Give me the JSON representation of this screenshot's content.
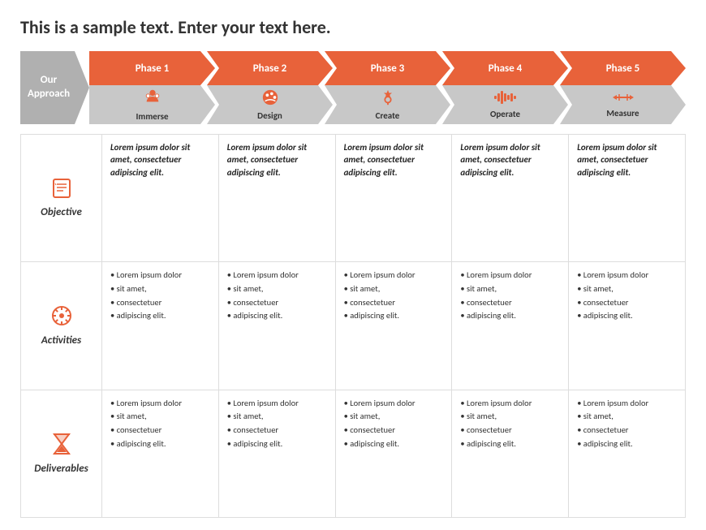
{
  "title": "This is a sample text. Enter your text here.",
  "banner": {
    "approach_label": "Our\nApproach",
    "phases": [
      {
        "phase_label": "Phase 1",
        "icon": "👤",
        "icon_unicode": "🫧",
        "sub_label": "Immerse"
      },
      {
        "phase_label": "Phase 2",
        "icon": "🎨",
        "sub_label": "Design"
      },
      {
        "phase_label": "Phase 3",
        "icon": "⚙️",
        "sub_label": "Create"
      },
      {
        "phase_label": "Phase 4",
        "icon": "📊",
        "sub_label": "Operate"
      },
      {
        "phase_label": "Phase 5",
        "icon": "⟷",
        "sub_label": "Measure"
      }
    ]
  },
  "rows": [
    {
      "header_label": "Objective",
      "icon": "📋",
      "type": "bold",
      "cells": [
        "Lorem ipsum dolor sit amet, consectetuer adipiscing elit.",
        "Lorem ipsum dolor sit amet, consectetuer adipiscing elit.",
        "Lorem ipsum dolor sit amet, consectetuer adipiscing elit.",
        "Lorem ipsum dolor sit amet, consectetuer adipiscing elit.",
        "Lorem ipsum dolor sit amet, consectetuer adipiscing elit."
      ]
    },
    {
      "header_label": "Activities",
      "icon": "✳",
      "type": "list",
      "cells": [
        [
          "Lorem ipsum dolor",
          "sit amet,",
          "consectetuer",
          "adipiscing elit."
        ],
        [
          "Lorem ipsum dolor",
          "sit amet,",
          "consectetuer",
          "adipiscing elit."
        ],
        [
          "Lorem ipsum dolor",
          "sit amet,",
          "consectetuer",
          "adipiscing elit."
        ],
        [
          "Lorem ipsum dolor",
          "sit amet,",
          "consectetuer",
          "adipiscing elit."
        ],
        [
          "Lorem ipsum dolor",
          "sit amet,",
          "consectetuer",
          "adipiscing elit."
        ]
      ]
    },
    {
      "header_label": "Deliverables",
      "icon": "⏳",
      "type": "list",
      "cells": [
        [
          "Lorem ipsum dolor",
          "sit amet,",
          "consectetuer",
          "adipiscing elit."
        ],
        [
          "Lorem ipsum dolor",
          "sit amet,",
          "consectetuer",
          "adipiscing elit."
        ],
        [
          "Lorem ipsum dolor",
          "sit amet,",
          "consectetuer",
          "adipiscing elit."
        ],
        [
          "Lorem ipsum dolor",
          "sit amet,",
          "consectetuer",
          "adipiscing elit."
        ],
        [
          "Lorem ipsum dolor",
          "sit amet,",
          "consectetuer",
          "adipiscing elit."
        ]
      ]
    }
  ],
  "colors": {
    "orange": "#e8623a",
    "gray": "#b0b0b0",
    "light_gray": "#c8c8c8",
    "text_dark": "#333333"
  }
}
